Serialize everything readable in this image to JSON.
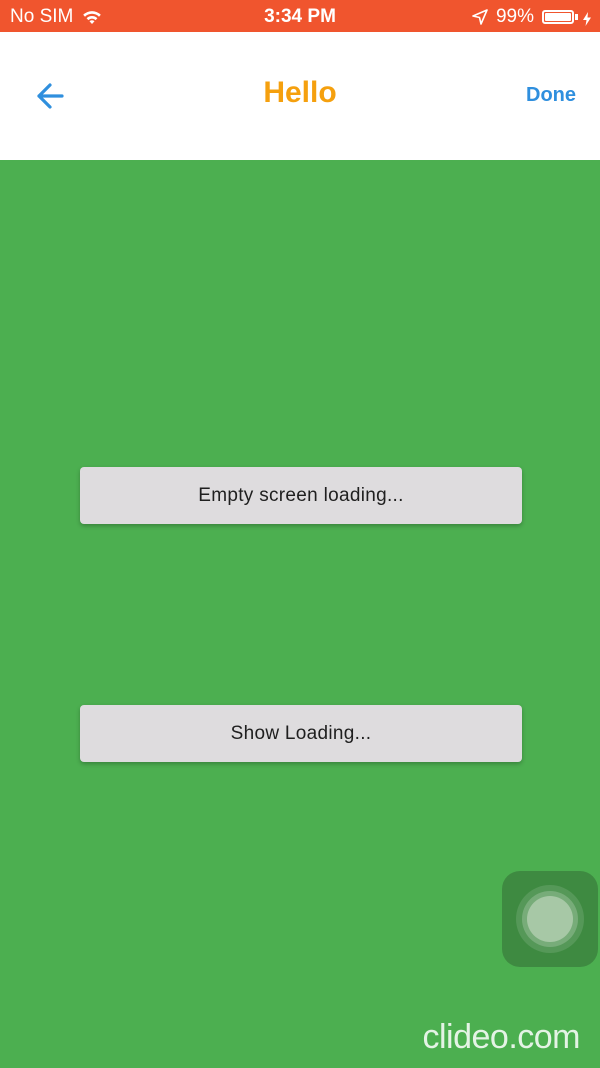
{
  "status_bar": {
    "carrier": "No SIM",
    "time": "3:34 PM",
    "battery": "99%",
    "battery_level": 0.99,
    "icons": [
      "wifi-icon",
      "location-icon",
      "battery-icon",
      "charging-icon"
    ]
  },
  "nav_bar": {
    "back_icon": "arrow-left-icon",
    "title": "Hello",
    "done_label": "Done"
  },
  "buttons": {
    "empty_screen": "Empty screen loading...",
    "show_loading": "Show Loading..."
  },
  "assistive_touch": {
    "icon": "assistive-touch-icon"
  },
  "watermark": "clideo.com",
  "colors": {
    "status_bar_bg": "#f0552e",
    "screen_bg": "#4caf50",
    "title": "#f5a00e",
    "accent": "#2f8fde",
    "button_bg": "#dedcde"
  }
}
